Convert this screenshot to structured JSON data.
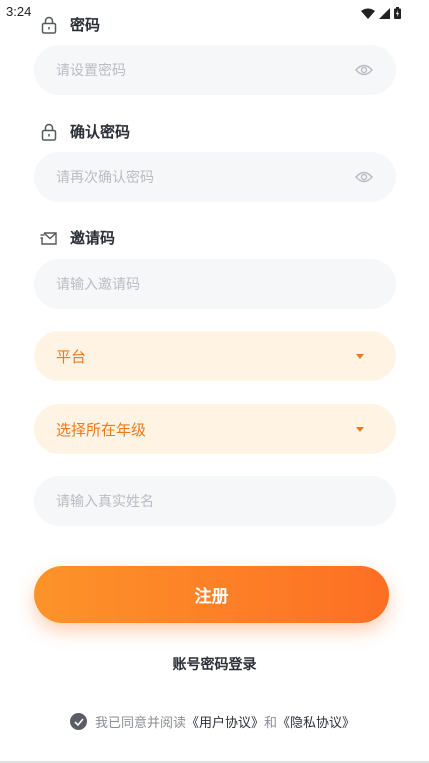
{
  "status_bar": {
    "time": "3:24"
  },
  "fields": {
    "password": {
      "label": "密码",
      "placeholder": "请设置密码"
    },
    "confirm_password": {
      "label": "确认密码",
      "placeholder": "请再次确认密码"
    },
    "invite_code": {
      "label": "邀请码",
      "placeholder": "请输入邀请码"
    },
    "real_name": {
      "placeholder": "请输入真实姓名"
    }
  },
  "selects": {
    "platform": {
      "value": "平台"
    },
    "grade": {
      "value": "选择所在年级"
    }
  },
  "register_button": {
    "label": "注册"
  },
  "login_link": {
    "label": "账号密码登录"
  },
  "agreement": {
    "prefix": "我已同意并阅读",
    "user_agreement": "《用户协议》",
    "conjunction": "和",
    "privacy_agreement": "《隐私协议》"
  },
  "colors": {
    "accent": "#f07a1b",
    "button_start": "#fd9329",
    "button_end": "#fd6f24",
    "input_bg": "#f6f7f9",
    "select_bg": "#fff3e3"
  }
}
